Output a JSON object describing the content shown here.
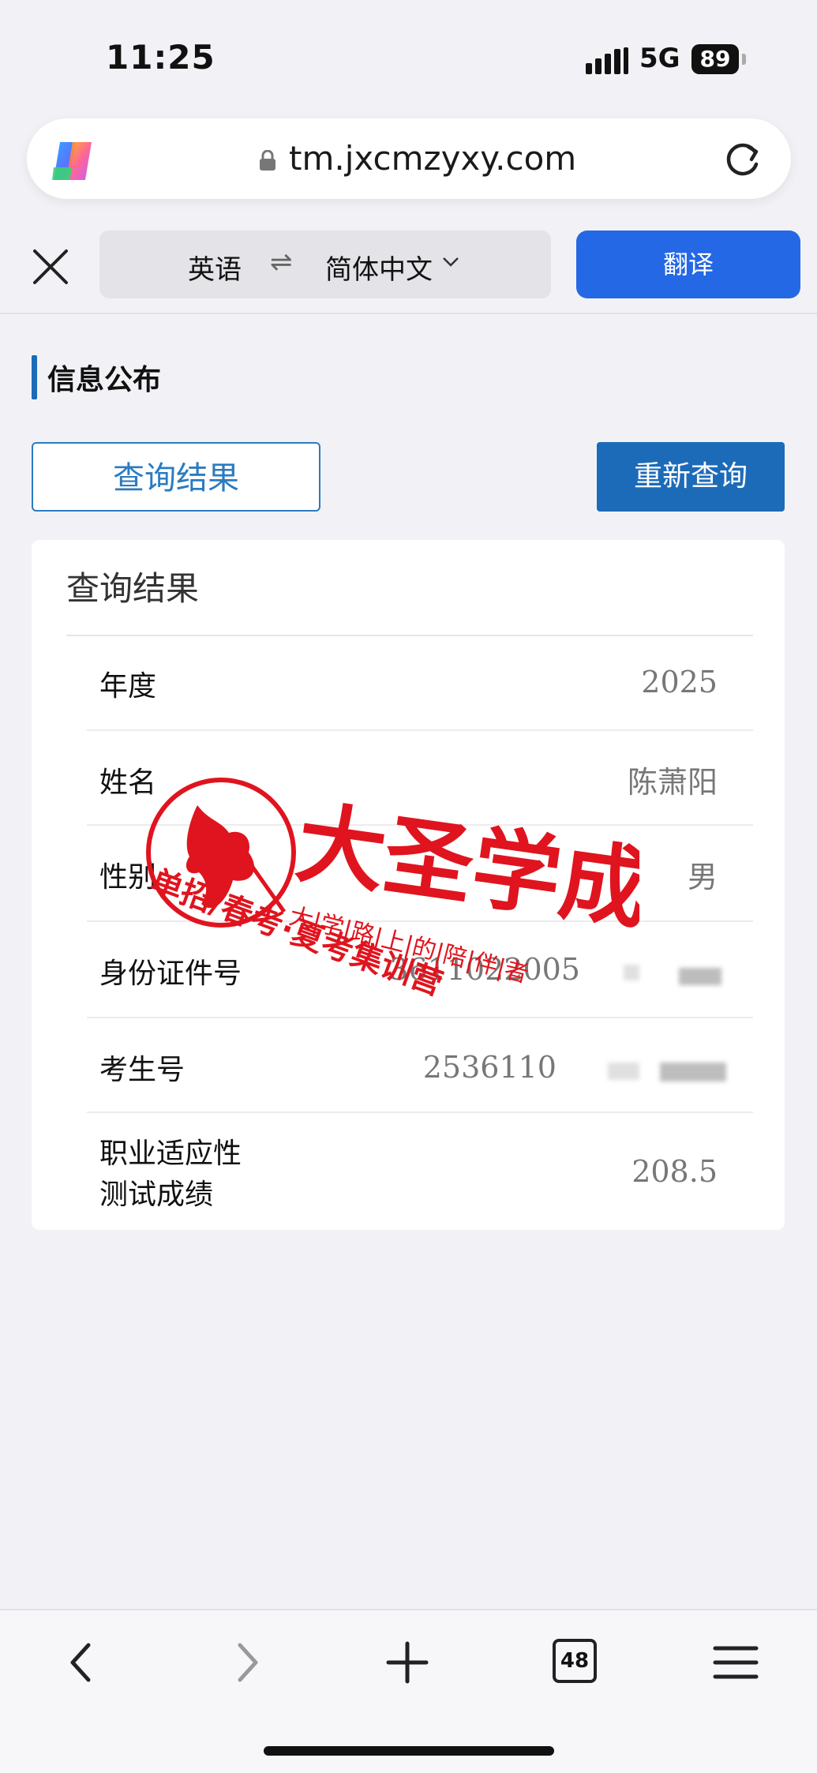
{
  "status_bar": {
    "time": "11:25",
    "network": "5G",
    "battery": "89"
  },
  "browser": {
    "url": "tm.jxcmzyxy.com"
  },
  "translate_bar": {
    "source_lang": "英语",
    "swap_symbol": "⇌",
    "target_lang": "简体中文",
    "translate_label": "翻译"
  },
  "page": {
    "section_title": "信息公布",
    "query_button": "查询结果",
    "requery_button": "重新查询",
    "card_title": "查询结果",
    "rows": [
      {
        "label": "年度",
        "value": "2025"
      },
      {
        "label": "姓名",
        "value": "陈萧阳"
      },
      {
        "label": "性别",
        "value": "男"
      },
      {
        "label": "身份证件号",
        "value": "3611022005"
      },
      {
        "label": "考生号",
        "value": "2536110"
      },
      {
        "label": "职业适应性",
        "label2": "测试成绩",
        "value": "208.5"
      }
    ]
  },
  "watermark": {
    "brand": "大圣学成",
    "line1": "大|学|路|上|的|陪|伴|者",
    "line2": "单招/春考·夏考集训营",
    "color": "#e0141e"
  },
  "bottom_toolbar": {
    "tab_count": "48"
  }
}
